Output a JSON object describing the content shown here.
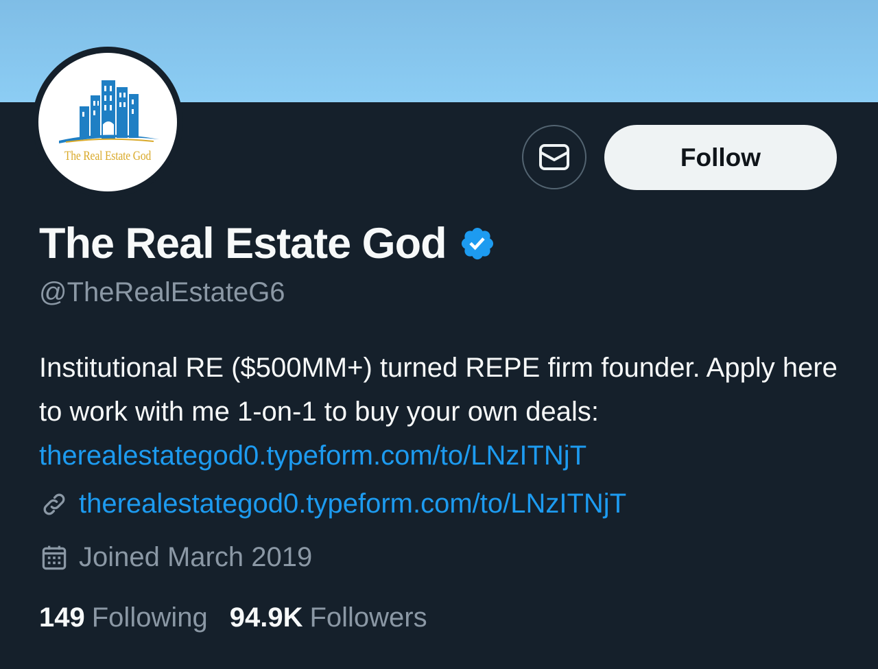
{
  "profile": {
    "display_name": "The Real Estate God",
    "handle": "@TheRealEstateG6",
    "avatar_text": "The Real Estate God",
    "verified_icon": "verified-badge-icon",
    "bio_text": "Institutional RE ($500MM+) turned REPE firm founder. Apply here to work with me 1-on-1 to buy your own deals: ",
    "bio_link": "therealestategod0.typeform.com/to/LNzITNjT",
    "website": "therealestategod0.typeform.com/to/LNzITNjT",
    "joined": "Joined March 2019"
  },
  "actions": {
    "message_icon": "mail-icon",
    "follow_label": "Follow"
  },
  "stats": {
    "following_count": "149",
    "following_label": "Following",
    "followers_count": "94.9K",
    "followers_label": "Followers"
  },
  "colors": {
    "background": "#15202b",
    "accent": "#1d9bf0",
    "muted": "#8b98a5",
    "banner": "#8ccdf4"
  }
}
